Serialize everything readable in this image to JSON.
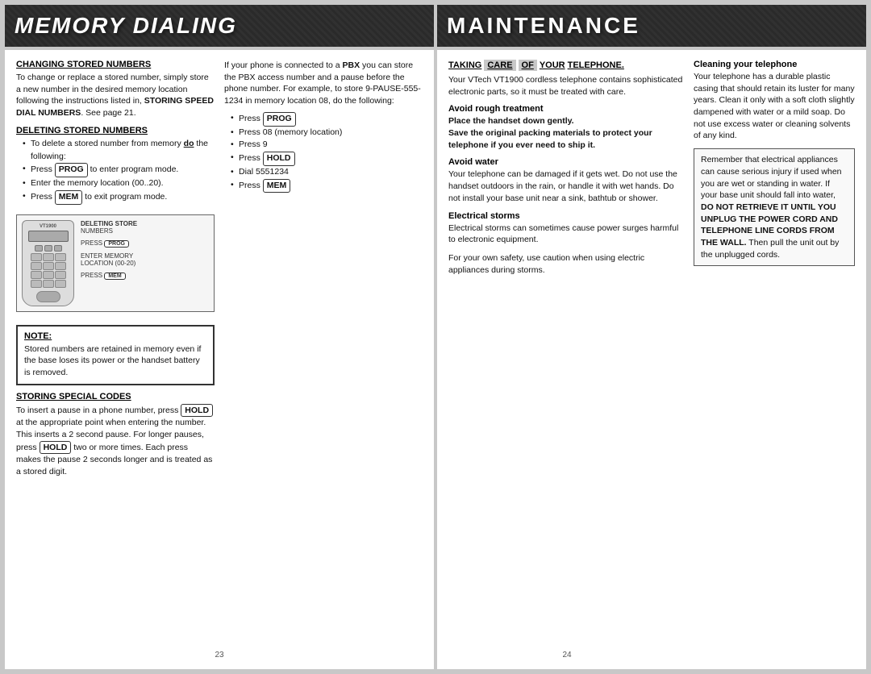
{
  "headers": {
    "left_title": "MEMORY DIALING",
    "right_title": "MAINTENANCE"
  },
  "left_page": {
    "sections": {
      "changing_stored": {
        "title": "CHANGING STORED NUMBERS",
        "body": "To change or replace a stored number, simply store a new number in the desired memory location following the instructions listed in, STORING SPEED DIAL NUMBERS. See page 21."
      },
      "deleting_stored": {
        "title": "DELETING STORED NUMBERS",
        "bullets": [
          "To delete a stored number from memory do the following:",
          "Press PROG to enter program mode.",
          "Enter the memory location (00..20).",
          "Press MEM to exit program mode."
        ]
      },
      "note": {
        "title": "NOTE:",
        "body": "Stored numbers are retained in memory even if the base loses its power or the handset battery is removed."
      },
      "storing_special": {
        "title": "STORING SPECIAL CODES",
        "body": "To insert a pause in a phone number, press HOLD at the appropriate point when entering the number. This inserts a 2 second pause. For longer pauses, press HOLD two or more times. Each press makes the pause 2 seconds longer and is treated as a stored digit."
      }
    },
    "pbx_section": {
      "intro": "If your phone is connected to a PBX you can store the PBX access number and a pause before the phone number. For example, to store 9-PAUSE-555-1234 in memory location 08, do the following:",
      "bullets": [
        "Press PROG",
        "Press 08 (memory location)",
        "Press 9",
        "Press HOLD",
        "Dial 5551234",
        "Press MEM"
      ]
    },
    "phone_diagram": {
      "labels": [
        "DELETING STORE NUMBERS",
        "PRESS PROG",
        "ENTER MEMORY LOCATION (00-20)",
        "PRESS MEM"
      ]
    },
    "page_number": "23"
  },
  "right_page": {
    "taking_care": {
      "words": [
        "TAKING",
        "CARE",
        "OF",
        "YOUR"
      ],
      "highlighted_indices": [
        1,
        2
      ],
      "subtitle": "TELEPHONE.",
      "body": "Your VTech VT1900 cordless telephone contains sophisticated electronic parts, so it must be treated with care."
    },
    "avoid_rough": {
      "title": "Avoid rough treatment",
      "body": "Place the handset down gently. Save the original packing materials to protect your telephone if you ever need to ship it."
    },
    "avoid_water": {
      "title": "Avoid water",
      "body": "Your telephone can be damaged if it gets wet. Do not use the handset outdoors in the rain, or handle it with wet hands. Do not install your base unit near a sink, bathtub or shower."
    },
    "electrical_storms": {
      "title": "Electrical storms",
      "body": "Electrical storms can sometimes cause power surges harmful to electronic equipment.",
      "extra": "For your own safety, use caution when using electric appliances during storms."
    },
    "cleaning": {
      "title": "Cleaning your telephone",
      "body": "Your telephone has a durable plastic casing that should retain its luster for many years. Clean it only with a soft cloth slightly dampened with water or a mild soap. Do not use excess water or cleaning solvents of any kind."
    },
    "warning_box": {
      "body": "Remember that electrical appliances can cause serious injury if used when you are wet or standing in water. If your base unit should fall into water, DO NOT RETRIEVE IT UNTIL YOU UNPLUG THE POWER CORD AND TELEPHONE LINE CORDS FROM THE WALL. Then pull the unit out by the unplugged cords."
    },
    "page_number": "24"
  }
}
